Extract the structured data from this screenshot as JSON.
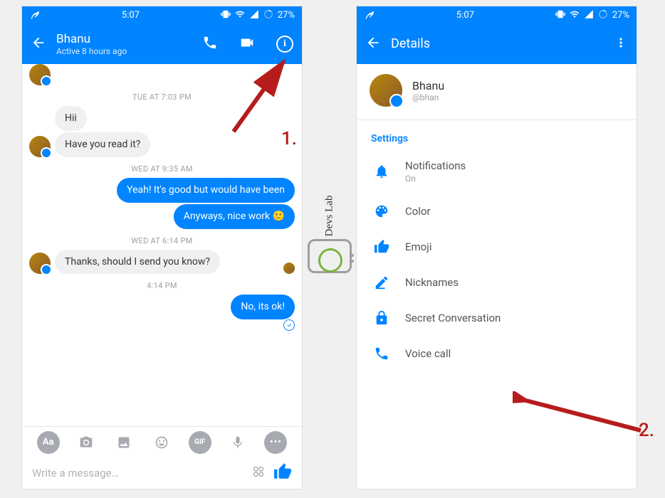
{
  "statusbar": {
    "time": "5:07",
    "battery": "27%"
  },
  "chat": {
    "header": {
      "name": "Bhanu",
      "status": "Active 8 hours ago"
    },
    "tue_time": "TUE AT 7:03 PM",
    "msg_hii": "Hii",
    "msg_read": "Have you read it?",
    "wed1_time": "WED AT 9:35 AM",
    "msg_yeah": "Yeah! It's good but would have been",
    "msg_anyways": "Anyways, nice work 🙂",
    "wed2_time": "WED AT 6:14 PM",
    "msg_thanks": "Thanks, should I send you know?",
    "time_414": "4:14 PM",
    "msg_noitsok": "No, its ok!",
    "composer": {
      "placeholder": "Write a message…",
      "aa": "Aa",
      "gif": "GIF"
    }
  },
  "details": {
    "title": "Details",
    "profile": {
      "name": "Bhanu",
      "handle": "@bhan"
    },
    "section": "Settings",
    "items": {
      "notifications": {
        "label": "Notifications",
        "sub": "On"
      },
      "color": {
        "label": "Color"
      },
      "emoji": {
        "label": "Emoji"
      },
      "nicknames": {
        "label": "Nicknames"
      },
      "secret": {
        "label": "Secret Conversation"
      },
      "voice": {
        "label": "Voice call"
      }
    }
  },
  "annotation": {
    "one": "1.",
    "two": "2."
  },
  "logo": {
    "text": "Devs Lab",
    "dot": "."
  }
}
